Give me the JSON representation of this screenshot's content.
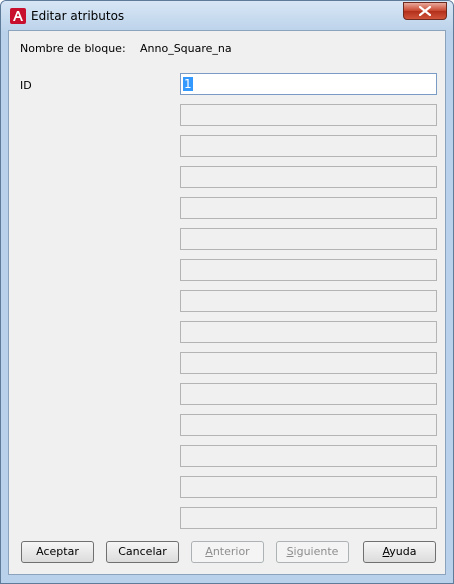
{
  "window": {
    "title": "Editar atributos"
  },
  "block": {
    "name_label": "Nombre de bloque:",
    "name_value": "Anno_Square_na"
  },
  "attributes": [
    {
      "tag": "ID",
      "value": "1"
    }
  ],
  "empty_field_count": 14,
  "buttons": {
    "accept": {
      "first": "Aceptar",
      "rest": ""
    },
    "cancel": {
      "first": "Cancelar",
      "rest": ""
    },
    "prev": {
      "first": "A",
      "rest": "nterior"
    },
    "next": {
      "first": "S",
      "rest": "iguiente"
    },
    "help": {
      "first": "A",
      "rest": "yuda"
    }
  },
  "icons": {
    "app": "autocad-icon",
    "close": "close-icon"
  },
  "colors": {
    "selection": "#3399ff",
    "app_icon_red": "#c8102e",
    "close_button": "#c7452d"
  }
}
